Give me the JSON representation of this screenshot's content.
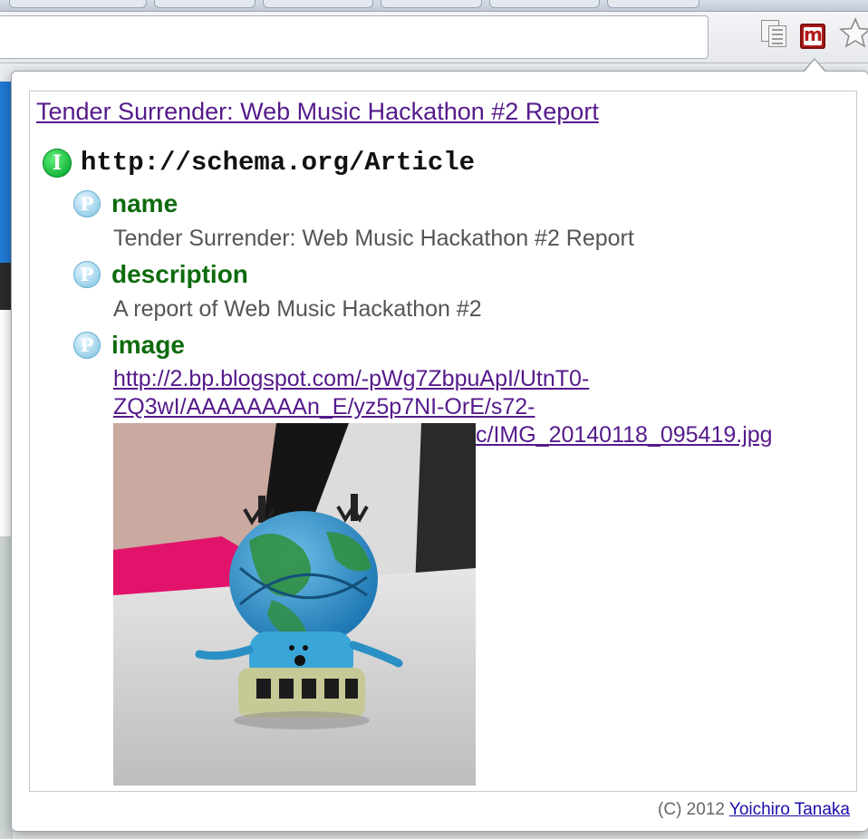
{
  "extension": {
    "badge_letter": "m",
    "brand_color": "#b31b1b"
  },
  "popup": {
    "title_link": "Tender Surrender: Web Music Hackathon #2 Report",
    "item": {
      "type_badge": "I",
      "type": "http://schema.org/Article",
      "properties": [
        {
          "badge": "P",
          "name": "name",
          "value": "Tender Surrender: Web Music Hackathon #2 Report"
        },
        {
          "badge": "P",
          "name": "description",
          "value": "A report of Web Music Hackathon #2"
        },
        {
          "badge": "P",
          "name": "image",
          "link_lines": [
            "http://2.bp.blogspot.com/-pWg7ZbpuApI/UtnT0-",
            "ZQ3wI/AAAAAAAAn_E/yz5p7NI-OrE/s72-",
            "c/IMG_20140118_095419.jpg"
          ]
        }
      ]
    },
    "footer": {
      "copyright": "(C) 2012",
      "author": "Yoichiro Tanaka"
    }
  },
  "colors": {
    "link": "#551a8b",
    "property_name": "#0d6b0d",
    "item_badge": "#13b53a",
    "property_badge": "#8fcbe6"
  }
}
